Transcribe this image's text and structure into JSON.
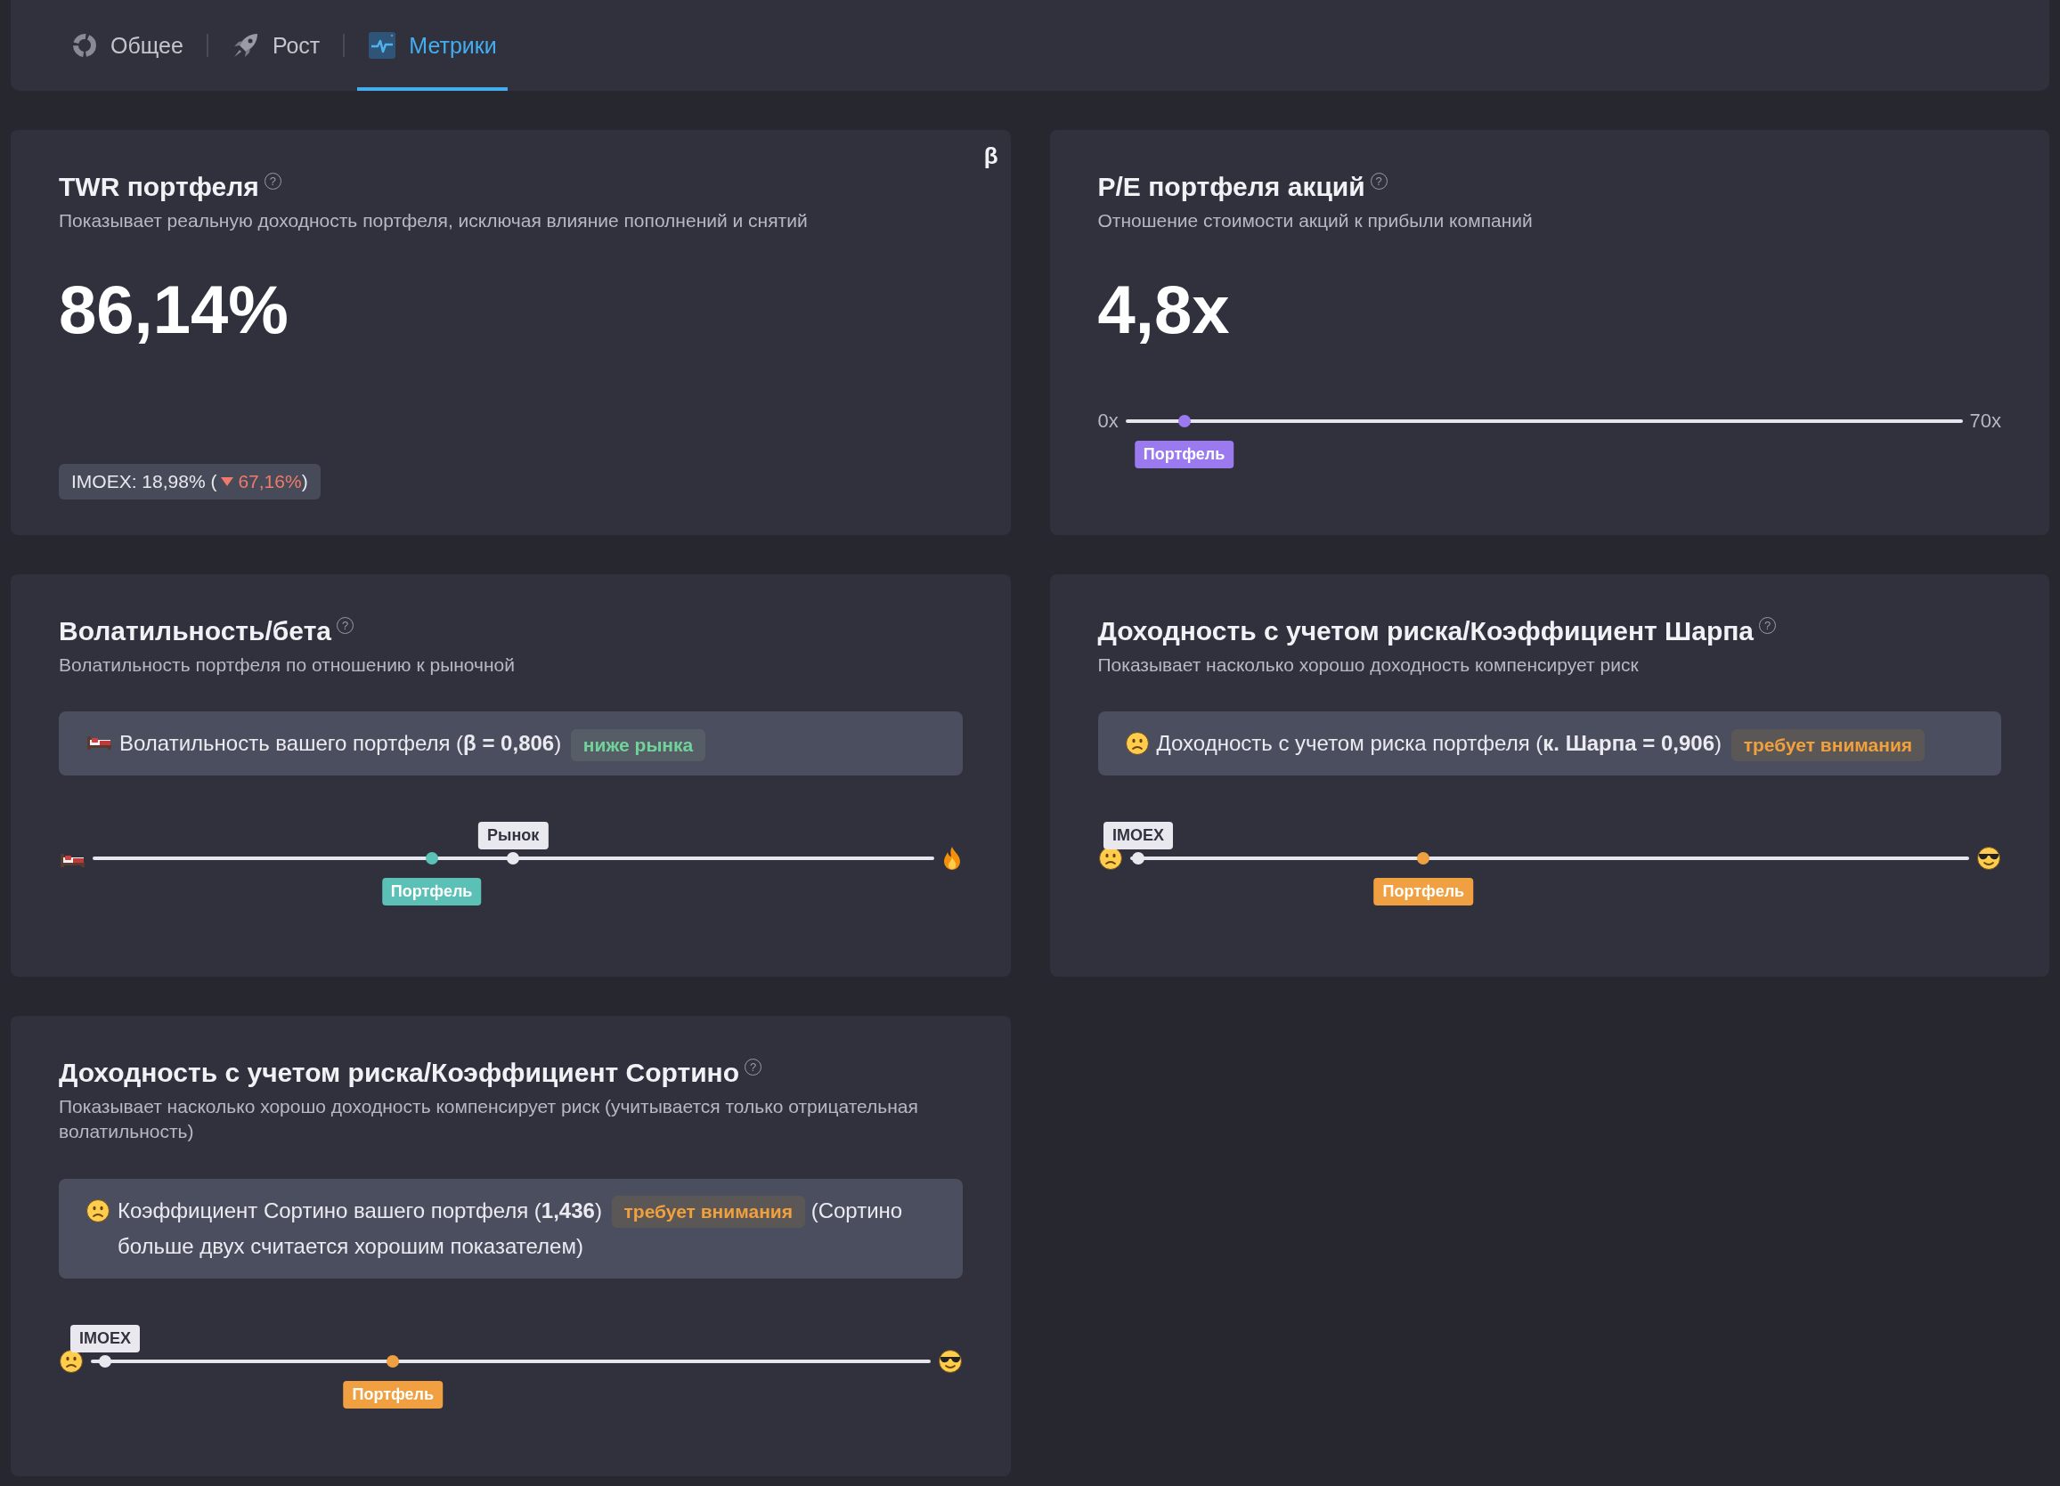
{
  "tabs": [
    {
      "label": "Общее",
      "selected": false
    },
    {
      "label": "Рост",
      "selected": false
    },
    {
      "label": "Метрики",
      "selected": true
    }
  ],
  "cards": [
    {
      "kind": "return",
      "title": "TWR портфеля",
      "help": "?",
      "corner_mark": "β",
      "subtitle": "Показывает реальную доходность портфеля, исключая влияние пополнений и снятий",
      "value": "86,14%",
      "benchmark": {
        "prefix": "IMOEX: 18,98% (",
        "delta": "67,16%",
        "down": true,
        "suffix": ")"
      }
    },
    {
      "kind": "multiple",
      "title": "P/E портфеля акций",
      "help": "?",
      "subtitle": "Отношение стоимости акций к прибыли компаний",
      "value": "4,8x",
      "scale": {
        "start": "0x",
        "end": "70x",
        "markers": [
          {
            "label": "Портфель",
            "level": 0.07,
            "above": false,
            "color": "#9b7af0"
          }
        ]
      }
    },
    {
      "kind": "volatility",
      "title": "Волатильность/бета",
      "help": "?",
      "subtitle": "Волатильность портфеля по отношению к рыночной",
      "status": {
        "text": "Волатильность вашего портфеля (**β = 0,806**)",
        "tag": "ниже рынка",
        "warning": false
      },
      "scale": {
        "markers": [
          {
            "label": "Рынок",
            "level": 0.5,
            "above": true,
            "color": "#e8e8ee"
          },
          {
            "label": "Портфель",
            "level": 0.403,
            "above": false,
            "color": "#5bc0b5"
          }
        ]
      }
    },
    {
      "kind": "ratio",
      "title": "Доходность с учетом риска/Коэффициент Шарпа",
      "help": "?",
      "subtitle": "Показывает насколько хорошо доходность компенсирует риск",
      "status": {
        "text": "Доходность с учетом риска портфеля (**к. Шарпа = 0,906**)",
        "tag": "требует внимания",
        "warning": true
      },
      "scale": {
        "markers": [
          {
            "label": "IMOEX",
            "level": 0.01,
            "above": true,
            "color": "#e8e8ee"
          },
          {
            "label": "Портфель",
            "level": 0.35,
            "above": false,
            "color": "#f0a040"
          }
        ]
      }
    },
    {
      "kind": "ratio",
      "title": "Доходность с учетом риска/Коэффициент Сортино",
      "help": "?",
      "subtitle": "Показывает насколько хорошо доходность компенсирует риск (учитывается только отрицательная волатильность)",
      "status": {
        "text": "Коэффициент Сортино вашего портфеля (**1,436**)",
        "tag": "требует внимания",
        "warning": true,
        "tail": "(Сортино больше двух считается хорошим показателем)"
      },
      "scale": {
        "markers": [
          {
            "label": "IMOEX",
            "level": 0.017,
            "above": true,
            "color": "#e8e8ee"
          },
          {
            "label": "Портфель",
            "level": 0.36,
            "above": false,
            "color": "#f0a040"
          }
        ]
      }
    }
  ]
}
